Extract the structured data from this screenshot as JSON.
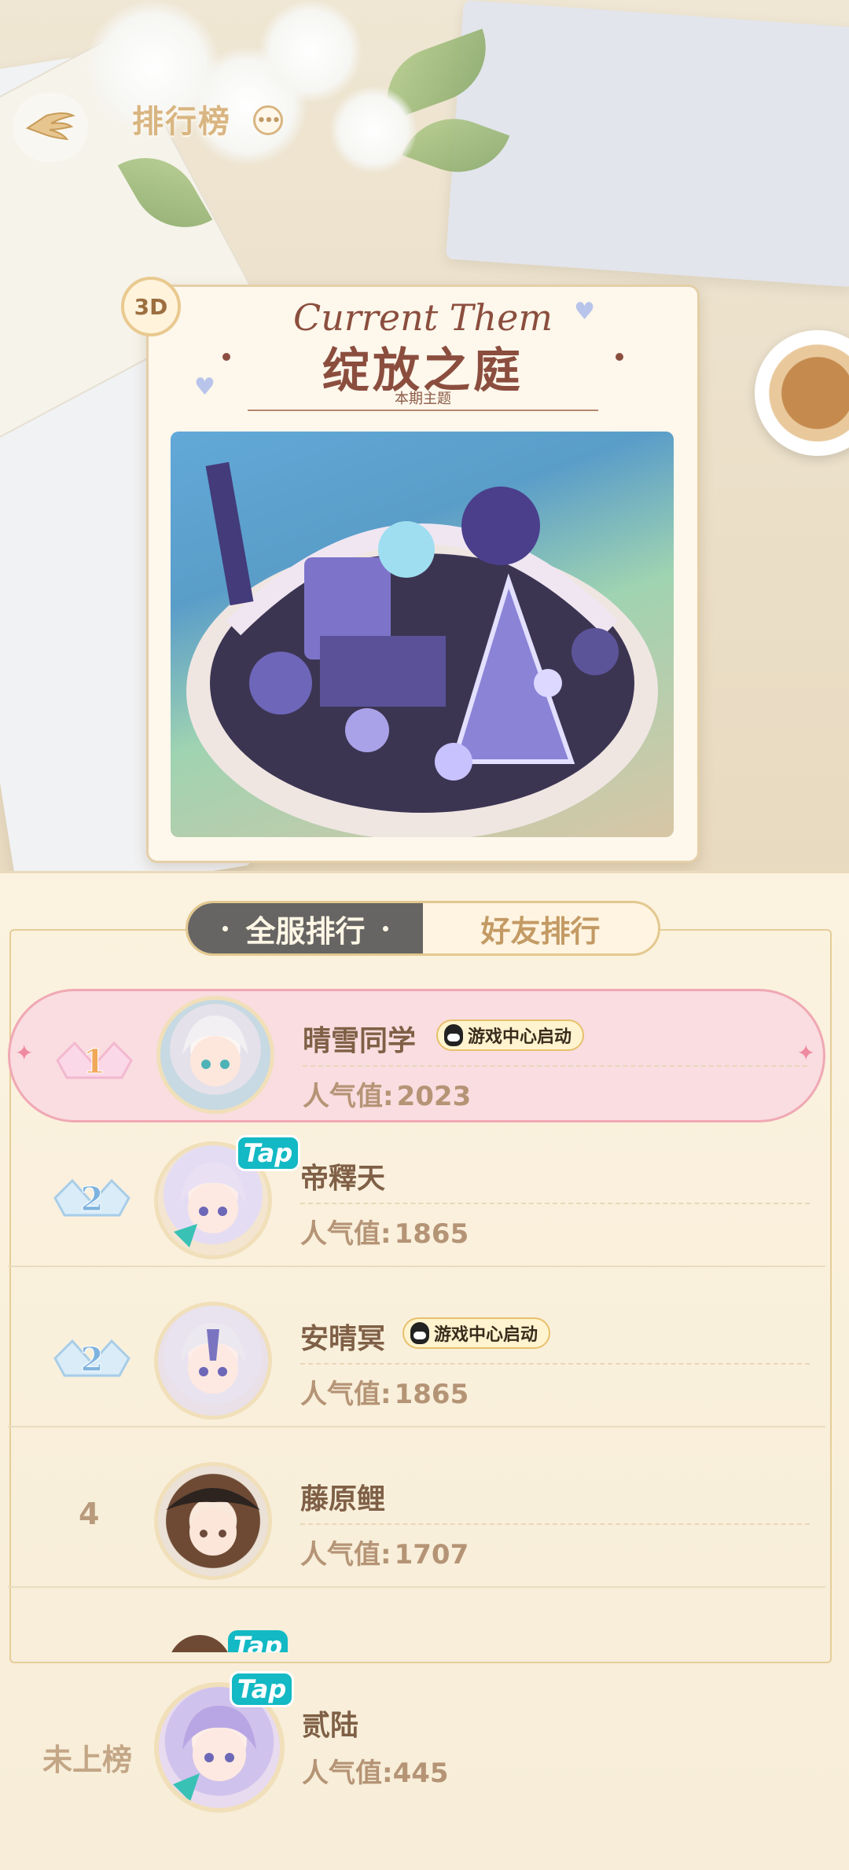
{
  "header": {
    "title": "排行榜",
    "back_icon": "wing-back-icon",
    "more_icon": "more-icon"
  },
  "theme": {
    "badge": "3D",
    "script_title": "Current Them",
    "name": "绽放之庭",
    "subtitle": "本期主题"
  },
  "tabs": [
    {
      "label": "全服排行",
      "active": true
    },
    {
      "label": "好友排行",
      "active": false
    }
  ],
  "popularity_label": "人气值:",
  "ranking": [
    {
      "rank": "1",
      "name": "晴雪同学",
      "qq_tag": "游戏中心启动",
      "popularity": "2023",
      "tap": false
    },
    {
      "rank": "2",
      "name": "帝釋天",
      "qq_tag": "",
      "popularity": "1865",
      "tap": true
    },
    {
      "rank": "2",
      "name": "安晴冥",
      "qq_tag": "游戏中心启动",
      "popularity": "1865",
      "tap": false
    },
    {
      "rank": "4",
      "name": "藤原鲤",
      "qq_tag": "",
      "popularity": "1707",
      "tap": false
    }
  ],
  "peek_tap": "Tap",
  "my_entry": {
    "rank": "未上榜",
    "name": "贰陆",
    "popularity_label": "人气值:",
    "popularity": "445",
    "tap": "Tap"
  },
  "colors": {
    "first_row_bg": "#f9dde0",
    "active_tab": "#676563",
    "accent_gold": "#d8b581",
    "tap_badge": "#13b9c4"
  }
}
